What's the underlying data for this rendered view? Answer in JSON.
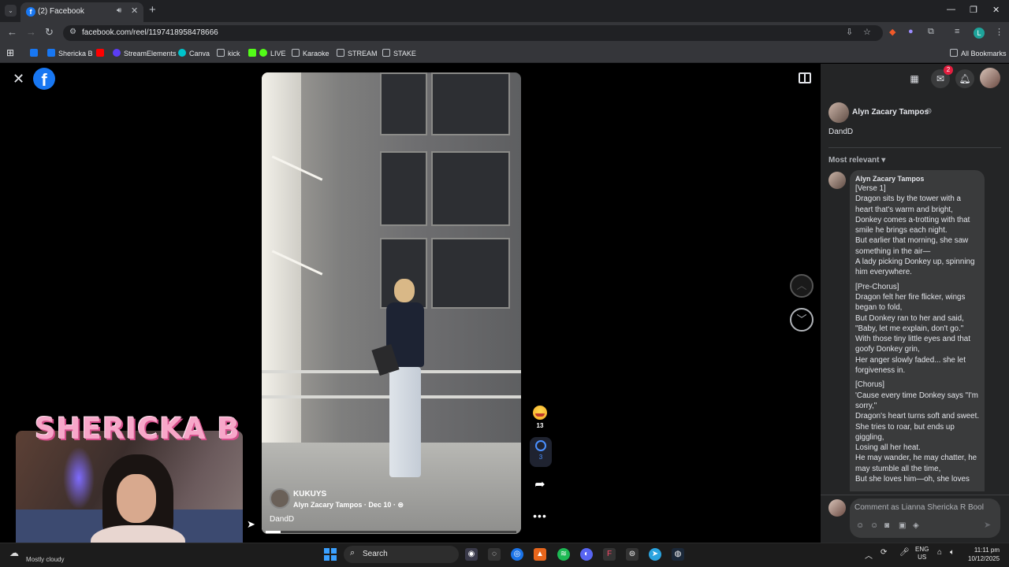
{
  "browser": {
    "tab_title": "(2) Facebook",
    "url": "facebook.com/reel/1197418958478666",
    "profile_initial": "L",
    "bookmarks": [
      {
        "label": "",
        "color": "#1877f2"
      },
      {
        "label": "Shericka B",
        "color": "#1877f2"
      },
      {
        "label": "",
        "color": "#ff0000"
      },
      {
        "label": "StreamElements",
        "color": "#5b3df5"
      },
      {
        "label": "Canva",
        "color": "#00c4cc"
      },
      {
        "label": "kick",
        "color": "#888888"
      },
      {
        "label": "LIVE",
        "color": "#53fc18"
      },
      {
        "label": "Karaoke",
        "color": "#888888"
      },
      {
        "label": "STREAM",
        "color": "#888888"
      },
      {
        "label": "STAKE",
        "color": "#888888"
      }
    ],
    "all_bookmarks": "All Bookmarks"
  },
  "reel": {
    "title": "KUKUYS",
    "author": "Alyn Zacary Tampos",
    "date": "Dec 10",
    "description": "DandD",
    "reaction_count": "13",
    "comment_count": "3",
    "progress": 0.06
  },
  "panel": {
    "author": "Alyn Zacary Tampos",
    "post_text": "DandD",
    "sort_label": "Most relevant",
    "notification_count": "2",
    "comment": {
      "author": "Alyn Zacary Tampos",
      "stanzas": [
        "[Verse 1]\nDragon sits by the tower with a heart that's warm and bright,\nDonkey comes a-trotting with that smile he brings each night.\nBut earlier that morning, she saw something in the air—\nA lady picking Donkey up, spinning him everywhere.",
        "[Pre-Chorus]\nDragon felt her fire flicker, wings began to fold,\nBut Donkey ran to her and said, \"Baby, let me explain, don't go.\"\nWith those tiny little eyes and that goofy Donkey grin,\nHer anger slowly faded... she let forgiveness in.",
        "[Chorus]\n'Cause every time Donkey says \"I'm sorry,\"\nDragon's heart turns soft and sweet.\nShe tries to roar, but ends up giggling,\nLosing all her heat.\nHe may wander, he may chatter, he may stumble all the time,\nBut she loves him—oh, she loves"
      ]
    },
    "comment_placeholder": "Comment as Lianna Shericka R Bool"
  },
  "overlay": {
    "streamer_name": "SHERICKA B",
    "weather": "Mostly cloudy"
  },
  "taskbar": {
    "search": "Search",
    "lang": "ENG",
    "region": "US",
    "time": "11:11 pm",
    "date": "10/12/2025"
  }
}
